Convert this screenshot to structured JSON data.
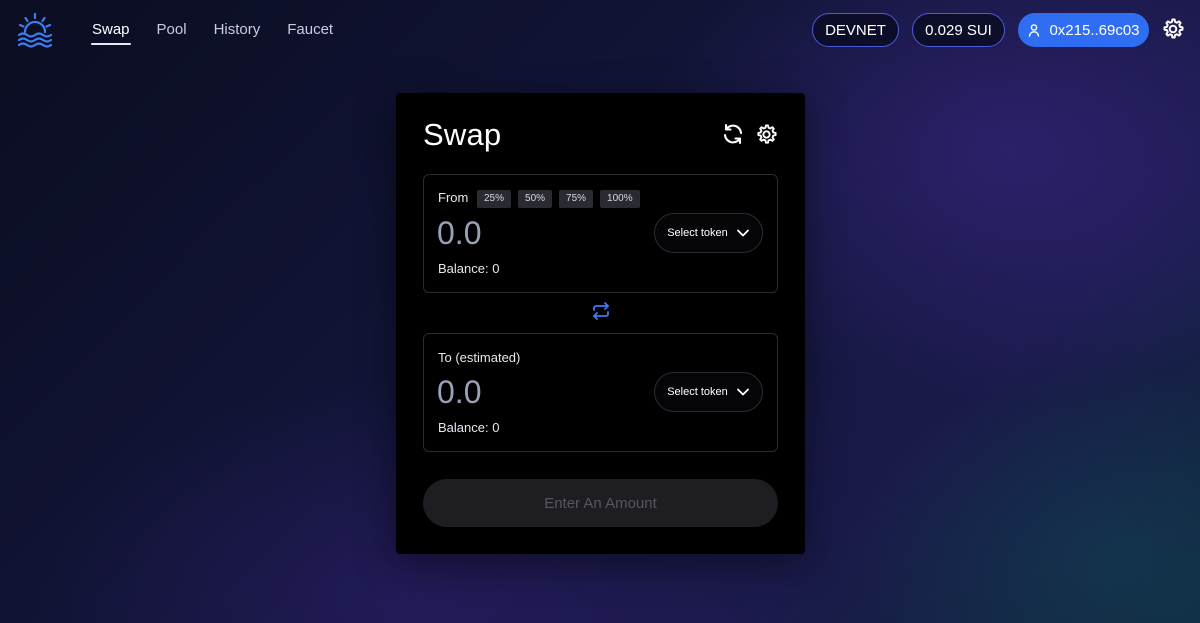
{
  "header": {
    "nav": [
      "Swap",
      "Pool",
      "History",
      "Faucet"
    ],
    "active_nav": "Swap",
    "network": "DEVNET",
    "balance": "0.029 SUI",
    "wallet": "0x215..69c03"
  },
  "swap": {
    "title": "Swap",
    "from": {
      "label": "From",
      "percentages": [
        "25%",
        "50%",
        "75%",
        "100%"
      ],
      "amount_placeholder": "0.0",
      "token_button": "Select token",
      "balance": "Balance: 0"
    },
    "to": {
      "label": "To (estimated)",
      "amount_placeholder": "0.0",
      "token_button": "Select token",
      "balance": "Balance: 0"
    },
    "cta": "Enter An Amount"
  },
  "colors": {
    "accent": "#2f6ef2",
    "swap_icon": "#3b7cf5",
    "logo": "#3f7df2"
  },
  "icons": {
    "logo": "water-sun-logo-icon",
    "wallet": "user-icon",
    "settings": "gear-icon",
    "refresh": "refresh-icon",
    "swap_direction": "swap-arrows-icon",
    "token_dropdown": "chevron-down-icon"
  }
}
